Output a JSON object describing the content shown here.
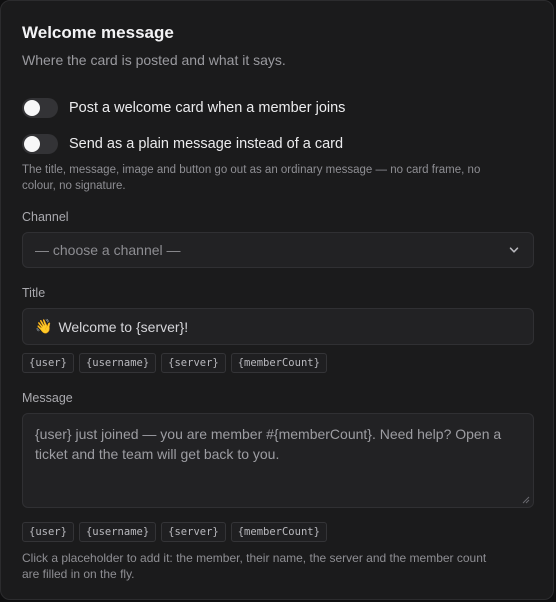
{
  "header": {
    "title": "Welcome message",
    "subtitle": "Where the card is posted and what it says."
  },
  "toggles": [
    {
      "label": "Post a welcome card when a member joins",
      "on": false
    },
    {
      "label": "Send as a plain message instead of a card",
      "on": false
    }
  ],
  "plain_hint_line1": "The title, message, image and button go out as an ordinary message — no card frame, no",
  "plain_hint_line2": "colour, no signature.",
  "channel": {
    "label": "Channel",
    "selected": "— choose a channel —"
  },
  "title_field": {
    "label": "Title",
    "emoji": "👋",
    "value": "Welcome to {server}!"
  },
  "placeholders": [
    "{user}",
    "{username}",
    "{server}",
    "{memberCount}"
  ],
  "message_field": {
    "label": "Message",
    "line1": "{user} just joined — you are member #{memberCount}. Need help? Open a",
    "line2": "ticket and the team will get back to you."
  },
  "footer_hint_line1": "Click a placeholder to add it: the member, their name, the server and the member count",
  "footer_hint_line2": "are filled in on the fly.",
  "icons": {
    "select_chevron": "chevron-down-icon",
    "resize_handle": "resize-grip-icon"
  },
  "colors": {
    "panel_bg": "#1b1b1c",
    "toggle_off": "#333336",
    "knob": "#f7f7f8"
  }
}
